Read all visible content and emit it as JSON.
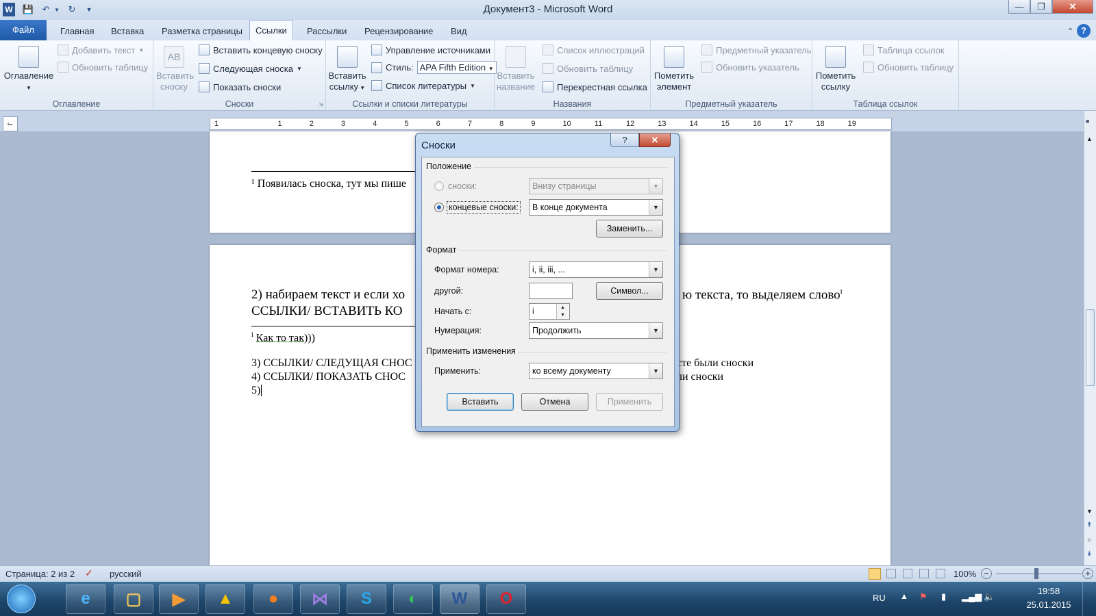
{
  "window": {
    "title": "Документ3 - Microsoft Word",
    "word_icon": "W"
  },
  "tabs": [
    "Файл",
    "Главная",
    "Вставка",
    "Разметка страницы",
    "Ссылки",
    "Рассылки",
    "Рецензирование",
    "Вид"
  ],
  "ribbon": {
    "toc": {
      "button": "Оглавление",
      "add_text": "Добавить текст",
      "update_table": "Обновить таблицу",
      "group": "Оглавление"
    },
    "footnotes": {
      "insert_footnote_big": "Вставить",
      "insert_footnote_big2": "сноску",
      "insert_endnote": "Вставить концевую сноску",
      "next_footnote": "Следующая сноска",
      "show_notes": "Показать сноски",
      "group": "Сноски"
    },
    "citations": {
      "insert_citation": "Вставить",
      "insert_citation2": "ссылку",
      "manage_sources": "Управление источниками",
      "style_label": "Стиль:",
      "style_value": "APA Fifth Edition",
      "bibliography": "Список литературы",
      "group": "Ссылки и списки литературы"
    },
    "captions": {
      "insert_caption": "Вставить",
      "insert_caption2": "название",
      "table_of_figures": "Список иллюстраций",
      "update_table": "Обновить таблицу",
      "cross_reference": "Перекрестная ссылка",
      "group": "Названия"
    },
    "index": {
      "mark_entry": "Пометить",
      "mark_entry2": "элемент",
      "insert_index": "Предметный указатель",
      "update_index": "Обновить указатель",
      "group": "Предметный указатель"
    },
    "toa": {
      "mark_citation": "Пометить",
      "mark_citation2": "ссылку",
      "insert_toa": "Таблица ссылок",
      "update_table": "Обновить таблицу",
      "group": "Таблица ссылок"
    }
  },
  "ruler_numbers": [
    "1",
    "1",
    "2",
    "3",
    "4",
    "5",
    "6",
    "7",
    "8",
    "9",
    "10",
    "11",
    "12",
    "13",
    "14",
    "15",
    "16",
    "17",
    "18",
    "19"
  ],
  "document": {
    "footnote_page1": "¹ Появилась сноска, тут мы пише",
    "line2a": "2) набираем текст и если хо",
    "line2b": "ю текста, то выделяем слово",
    "line2b_sup": "i",
    "line3": "ССЫЛКИ/ ВСТАВИТЬ КО",
    "endnote": "Как то так)))",
    "endnote_mark": "i",
    "line4a": "3) ССЫЛКИ/ СЛЕДУЩАЯ СНОС",
    "line4b": "сте были сноски",
    "line5a": "4) ССЫЛКИ/ ПОКАЗАТЬ СНОС",
    "line5b": "ли сноски",
    "line6": "5)"
  },
  "dialog": {
    "title": "Сноски",
    "help": "?",
    "close": "✕",
    "position_section": "Положение",
    "footnotes_label": "сноски:",
    "footnotes_value": "Внизу страницы",
    "endnotes_label": "концевые сноски:",
    "endnotes_value": "В конце документа",
    "replace_button": "Заменить...",
    "format_section": "Формат",
    "number_format_label": "Формат номера:",
    "number_format_value": "i, ii, iii, ...",
    "custom_label": "другой:",
    "custom_value": "",
    "symbol_button": "Символ...",
    "start_label": "Начать с:",
    "start_value": "i",
    "numbering_label": "Нумерация:",
    "numbering_value": "Продолжить",
    "apply_section": "Применить изменения",
    "apply_label": "Применить:",
    "apply_value": "ко всему документу",
    "insert_button": "Вставить",
    "cancel_button": "Отмена",
    "apply_button": "Применить",
    "selected_position": "endnotes"
  },
  "statusbar": {
    "page": "Страница: 2 из 2",
    "language": "русский",
    "zoom": "100%"
  },
  "taskbar": {
    "lang": "RU",
    "time": "19:58",
    "date": "25.01.2015"
  }
}
